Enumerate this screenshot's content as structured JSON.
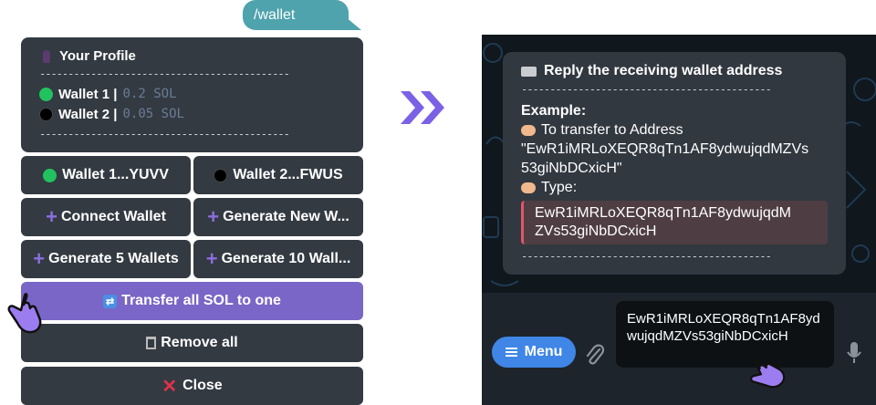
{
  "command": {
    "text": "/wallet"
  },
  "profile": {
    "title": "Your Profile",
    "separator": "--------------------------------------------",
    "wallets": [
      {
        "label": "Wallet 1 |",
        "balance": "0.2 SOL",
        "color": "#21c35e"
      },
      {
        "label": "Wallet 2 |",
        "balance": "0.05 SOL",
        "color": "#000000"
      }
    ]
  },
  "buttons": {
    "wallet1": "Wallet 1...YUVV",
    "wallet2": "Wallet 2...FWUS",
    "connect": "Connect Wallet",
    "generate_new": "Generate New W...",
    "generate5": "Generate 5 Wallets",
    "generate10": "Generate 10 Wall...",
    "transfer": "Transfer all SOL to one",
    "remove": "Remove all",
    "close": "Close"
  },
  "message": {
    "title": "Reply the receiving wallet address",
    "separator": "--------------------------------------------",
    "example": "Example:",
    "line1": "To transfer to Address",
    "address_quoted_1": "\"EwR1iMRLoXEQR8qTn1AF8ydwujqdMZVs",
    "address_quoted_2": "53giNbDCxicH\"",
    "type_label": "Type:",
    "code_1": "EwR1iMRLoXEQR8qTn1AF8ydwujqdM",
    "code_2": "ZVs53giNbDCxicH"
  },
  "composer": {
    "menu_label": "Menu",
    "input_value": "EwR1iMRLoXEQR8qTn1AF8ydwujqdMZVs53giNbDCxicH"
  },
  "colors": {
    "accent": "#7a66c7",
    "blue": "#3f86e6",
    "chat_bg": "#10171d"
  },
  "icons": [
    "pin-icon",
    "shuffle-icon",
    "trash-icon",
    "close-icon",
    "keyboard-icon",
    "pointing-hand-icon",
    "menu-icon",
    "attach-icon",
    "mic-icon",
    "double-chevron-icon",
    "cursor-hand-icon"
  ]
}
